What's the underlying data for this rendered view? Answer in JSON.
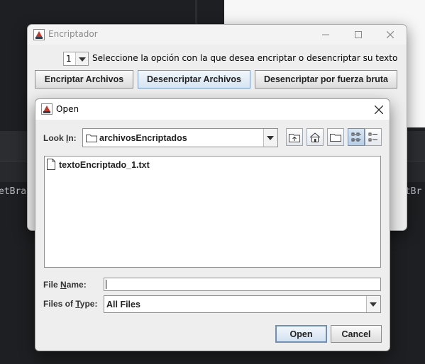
{
  "background": {
    "text_left": "etBrai",
    "text_right": "etBr"
  },
  "main_window": {
    "title": "Encriptador",
    "option_value": "1",
    "option_label": "Seleccione la opción con la que desea encriptar o desencriptar su texto",
    "buttons": {
      "encrypt": "Encriptar Archivos",
      "decrypt": "Desencriptar Archivos",
      "brute_force": "Desencriptar por fuerza bruta"
    }
  },
  "open_dialog": {
    "title": "Open",
    "look_in": {
      "label_pre": "Look ",
      "label_mn": "I",
      "label_post": "n:",
      "value": "archivosEncriptados"
    },
    "files": [
      {
        "name": "textoEncriptado_1.txt"
      }
    ],
    "file_name": {
      "label_pre": "File ",
      "label_mn": "N",
      "label_post": "ame:",
      "value": ""
    },
    "file_type": {
      "label_pre": "Files of ",
      "label_mn": "T",
      "label_post": "ype:",
      "value": "All Files"
    },
    "buttons": {
      "open": "Open",
      "cancel": "Cancel"
    }
  },
  "colors": {
    "background": "#1e1f22",
    "dialog": "#eeeeee",
    "accent_border": "#6f8fb3"
  }
}
